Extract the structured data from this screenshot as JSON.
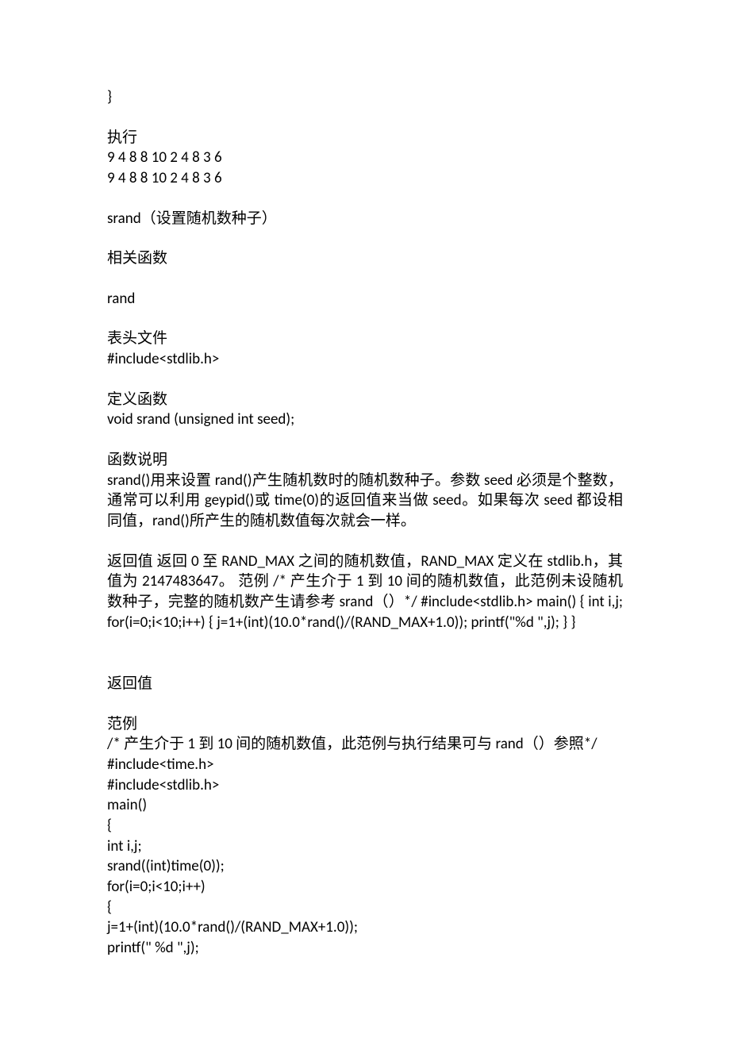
{
  "lines": {
    "l1": "}",
    "l2": "执行",
    "l3": "9 4 8 8 10 2 4 8 3 6",
    "l4": "9 4 8 8 10 2 4 8 3 6",
    "l5": "srand（设置随机数种子）",
    "l6": "相关函数",
    "l7": "rand",
    "l8": "表头文件",
    "l9": "#include<stdlib.h>",
    "l10": "定义函数",
    "l11": "void srand (unsigned int seed);",
    "l12": "函数说明",
    "l13": "srand()用来设置 rand()产生随机数时的随机数种子。参数 seed 必须是个整数，通常可以利用 geypid()或 time(0)的返回值来当做 seed。如果每次 seed 都设相同值，rand()所产生的随机数值每次就会一样。",
    "l14": "返回值  返回 0 至 RAND_MAX 之间的随机数值，RAND_MAX 定义在 stdlib.h，其值为 2147483647。 范例 /* 产生介于 1 到 10 间的随机数值，此范例未设随机数种子，完整的随机数产生请参考 srand（）*/ #include<stdlib.h> main() { int i,j; for(i=0;i<10;i++) { j=1+(int)(10.0*rand()/(RAND_MAX+1.0)); printf(\"%d \",j); } }",
    "l15": "返回值",
    "l16": "范例",
    "l17": "/* 产生介于 1 到 10 间的随机数值，此范例与执行结果可与 rand（）参照*/",
    "l18": "#include<time.h>",
    "l19": "#include<stdlib.h>",
    "l20": "main()",
    "l21": "{",
    "l22": "int i,j;",
    "l23": "srand((int)time(0));",
    "l24": "for(i=0;i<10;i++)",
    "l25": "{",
    "l26": "j=1+(int)(10.0*rand()/(RAND_MAX+1.0));",
    "l27": "printf(\" %d \",j);"
  }
}
